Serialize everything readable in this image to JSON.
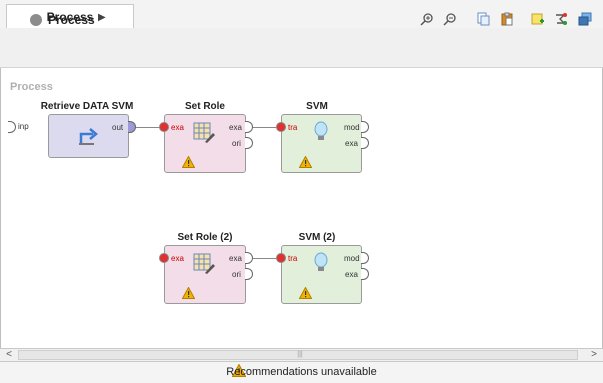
{
  "tab": {
    "label": "Process"
  },
  "toolbar": {
    "breadcrumb_label": "Process",
    "icons": [
      "zoom-in-icon",
      "zoom-out-icon",
      "copy-icon",
      "paste-icon",
      "add-note-icon",
      "route-icon",
      "layers-icon"
    ]
  },
  "canvas": {
    "title": "Process",
    "input_port_label": "inp"
  },
  "operators": {
    "retrieve": {
      "title": "Retrieve DATA SVM",
      "out_label": "out"
    },
    "setrole1": {
      "title": "Set Role",
      "in_label": "exa",
      "out1_label": "exa",
      "out2_label": "ori"
    },
    "svm1": {
      "title": "SVM",
      "in_label": "tra",
      "out1_label": "mod",
      "out2_label": "exa"
    },
    "setrole2": {
      "title": "Set Role (2)",
      "in_label": "exa",
      "out1_label": "exa",
      "out2_label": "ori"
    },
    "svm2": {
      "title": "SVM (2)",
      "in_label": "tra",
      "out1_label": "mod",
      "out2_label": "exa"
    }
  },
  "status": {
    "recommendations": "Recommendations unavailable"
  },
  "colors": {
    "retrieve_bg": "#dcdaee",
    "setrole_bg": "#f3dde8",
    "svm_bg": "#e2efdb",
    "warning": "#f2b200",
    "error_port": "#e03030"
  }
}
